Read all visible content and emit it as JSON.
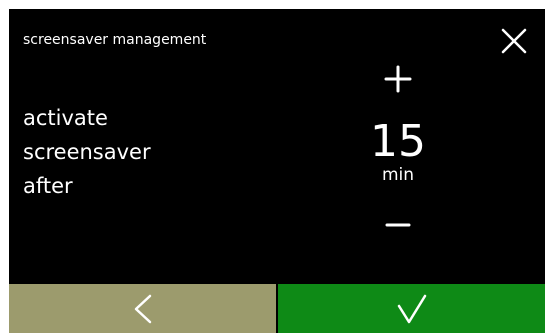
{
  "header": {
    "title": "screensaver management",
    "close_icon": "close-icon"
  },
  "prompt": {
    "lines": [
      "activate",
      "screensaver",
      "after"
    ]
  },
  "stepper": {
    "value": "15",
    "unit": "min",
    "increment_icon": "plus-icon",
    "decrement_icon": "minus-icon"
  },
  "footer": {
    "back_icon": "chevron-left-icon",
    "confirm_icon": "checkmark-icon",
    "back_color": "#9c9b6d",
    "confirm_color": "#0e8a16"
  },
  "colors": {
    "background": "#000000",
    "text": "#ffffff"
  }
}
